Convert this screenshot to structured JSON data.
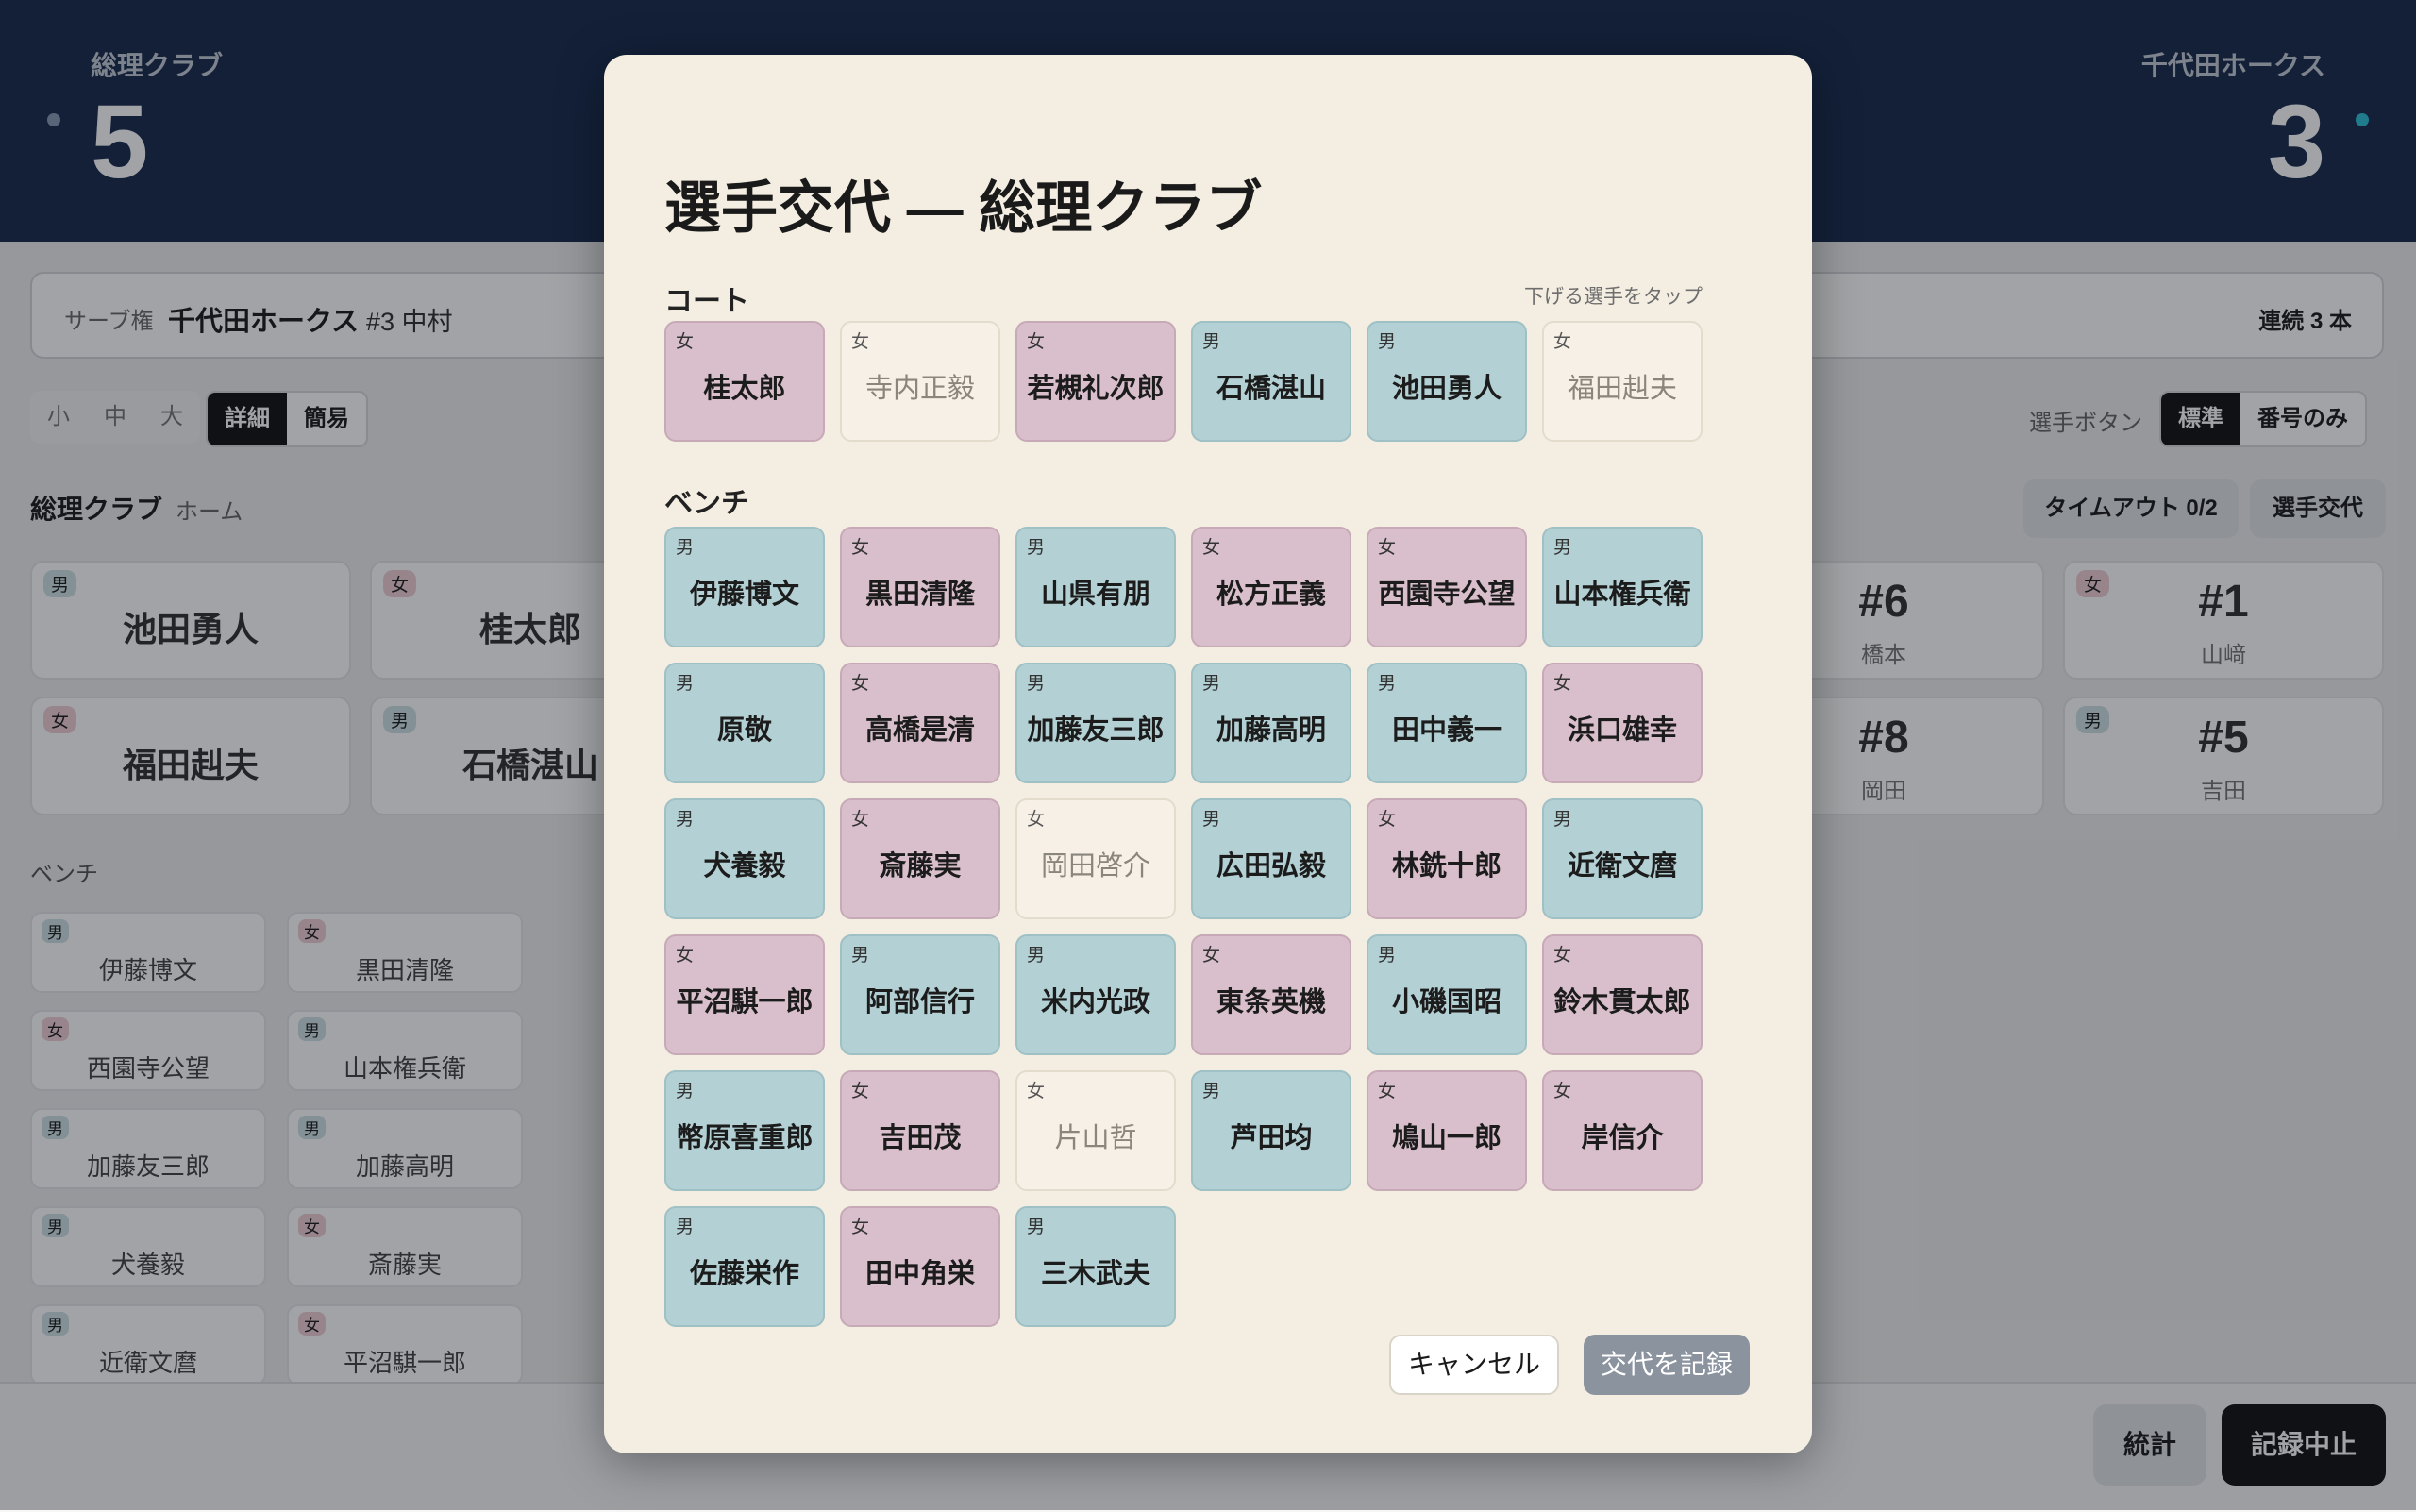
{
  "scoreboard": {
    "home_name": "総理クラブ",
    "home_score": "5",
    "away_name": "千代田ホークス",
    "away_score": "3"
  },
  "serve": {
    "label": "サーブ権",
    "team": "千代田ホークス",
    "player": "#3 中村",
    "streak": "連続 3 本"
  },
  "size_options": [
    "小",
    "中",
    "大"
  ],
  "mode_options": {
    "detail": "詳細",
    "simple": "簡易"
  },
  "player_button": {
    "label": "選手ボタン",
    "standard": "標準",
    "number_only": "番号のみ"
  },
  "home": {
    "title": "総理クラブ",
    "subtitle": "ホーム",
    "timeout": "タイムアウト 0/2",
    "substitution": "選手交代"
  },
  "bg_court": [
    {
      "g": "男",
      "name": "池田勇人"
    },
    {
      "g": "女",
      "name": "桂太郎"
    },
    {
      "g": "女",
      "name": "福田赳夫"
    },
    {
      "g": "男",
      "name": "石橋湛山"
    }
  ],
  "bg_away_court": [
    {
      "num": "#6",
      "name": "橋本"
    },
    {
      "g": "女",
      "num": "#1",
      "name": "山﨑"
    },
    {
      "num": "#8",
      "name": "岡田"
    },
    {
      "g": "男",
      "num": "#5",
      "name": "吉田"
    }
  ],
  "bg_bench_title": "ベンチ",
  "bg_bench": [
    {
      "g": "男",
      "name": "伊藤博文"
    },
    {
      "g": "女",
      "name": "黒田清隆"
    },
    {
      "g": "女",
      "name": "西園寺公望"
    },
    {
      "g": "男",
      "name": "山本権兵衛"
    },
    {
      "g": "男",
      "name": "加藤友三郎"
    },
    {
      "g": "男",
      "name": "加藤高明"
    },
    {
      "g": "男",
      "name": "犬養毅"
    },
    {
      "g": "女",
      "name": "斎藤実"
    },
    {
      "g": "男",
      "name": "近衛文麿"
    },
    {
      "g": "女",
      "name": "平沼騏一郎"
    }
  ],
  "bottom": {
    "stats": "統計",
    "stop": "記録中止"
  },
  "modal": {
    "title": "選手交代 — 総理クラブ",
    "court_label": "コート",
    "court_hint": "下げる選手をタップ",
    "bench_label": "ベンチ",
    "cancel": "キャンセル",
    "record": "交代を記録",
    "court": [
      {
        "g": "女",
        "name": "桂太郎",
        "state": "f"
      },
      {
        "g": "女",
        "name": "寺内正毅",
        "state": "disabled"
      },
      {
        "g": "女",
        "name": "若槻礼次郎",
        "state": "f"
      },
      {
        "g": "男",
        "name": "石橋湛山",
        "state": "m"
      },
      {
        "g": "男",
        "name": "池田勇人",
        "state": "m"
      },
      {
        "g": "女",
        "name": "福田赳夫",
        "state": "disabled"
      }
    ],
    "bench": [
      {
        "g": "男",
        "name": "伊藤博文",
        "state": "m"
      },
      {
        "g": "女",
        "name": "黒田清隆",
        "state": "f"
      },
      {
        "g": "男",
        "name": "山県有朋",
        "state": "m"
      },
      {
        "g": "女",
        "name": "松方正義",
        "state": "f"
      },
      {
        "g": "女",
        "name": "西園寺公望",
        "state": "f"
      },
      {
        "g": "男",
        "name": "山本権兵衛",
        "state": "m"
      },
      {
        "g": "男",
        "name": "原敬",
        "state": "m"
      },
      {
        "g": "女",
        "name": "高橋是清",
        "state": "f"
      },
      {
        "g": "男",
        "name": "加藤友三郎",
        "state": "m"
      },
      {
        "g": "男",
        "name": "加藤高明",
        "state": "m"
      },
      {
        "g": "男",
        "name": "田中義一",
        "state": "m"
      },
      {
        "g": "女",
        "name": "浜口雄幸",
        "state": "f"
      },
      {
        "g": "男",
        "name": "犬養毅",
        "state": "m"
      },
      {
        "g": "女",
        "name": "斎藤実",
        "state": "f"
      },
      {
        "g": "女",
        "name": "岡田啓介",
        "state": "disabled"
      },
      {
        "g": "男",
        "name": "広田弘毅",
        "state": "m"
      },
      {
        "g": "女",
        "name": "林銑十郎",
        "state": "f"
      },
      {
        "g": "男",
        "name": "近衛文麿",
        "state": "m"
      },
      {
        "g": "女",
        "name": "平沼騏一郎",
        "state": "f"
      },
      {
        "g": "男",
        "name": "阿部信行",
        "state": "m"
      },
      {
        "g": "男",
        "name": "米内光政",
        "state": "m"
      },
      {
        "g": "女",
        "name": "東条英機",
        "state": "f"
      },
      {
        "g": "男",
        "name": "小磯国昭",
        "state": "m"
      },
      {
        "g": "女",
        "name": "鈴木貫太郎",
        "state": "f"
      },
      {
        "g": "男",
        "name": "幣原喜重郎",
        "state": "m"
      },
      {
        "g": "女",
        "name": "吉田茂",
        "state": "f"
      },
      {
        "g": "女",
        "name": "片山哲",
        "state": "disabled"
      },
      {
        "g": "男",
        "name": "芦田均",
        "state": "m"
      },
      {
        "g": "女",
        "name": "鳩山一郎",
        "state": "f"
      },
      {
        "g": "女",
        "name": "岸信介",
        "state": "f"
      },
      {
        "g": "男",
        "name": "佐藤栄作",
        "state": "m"
      },
      {
        "g": "女",
        "name": "田中角栄",
        "state": "f"
      },
      {
        "g": "男",
        "name": "三木武夫",
        "state": "m"
      }
    ]
  }
}
